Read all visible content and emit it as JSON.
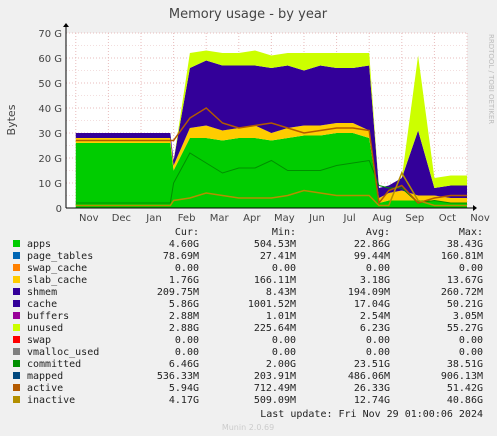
{
  "chart_data": {
    "type": "area",
    "title": "Memory usage - by year",
    "ylabel": "Bytes",
    "side_label": "RRDTOOL / TOBI OETIKER",
    "footer": "Munin 2.0.69",
    "last_update": "Last update: Fri Nov 29 01:00:06 2024",
    "ylim": [
      0,
      70
    ],
    "y_unit": "G",
    "y_ticks": [
      "0",
      "10 G",
      "20 G",
      "30 G",
      "40 G",
      "50 G",
      "60 G",
      "70 G"
    ],
    "x_ticks": [
      "Nov",
      "Dec",
      "Jan",
      "Feb",
      "Mar",
      "Apr",
      "May",
      "Jun",
      "Jul",
      "Aug",
      "Sep",
      "Oct",
      "Nov"
    ],
    "grid": true,
    "legend_headers": [
      "Cur:",
      "Min:",
      "Avg:",
      "Max:"
    ],
    "series": [
      {
        "name": "apps",
        "color": "#00cc00",
        "cur": "4.60G",
        "min": "504.53M",
        "avg": "22.86G",
        "max": "38.43G"
      },
      {
        "name": "page_tables",
        "color": "#0066b3",
        "cur": "78.69M",
        "min": "27.41M",
        "avg": "99.44M",
        "max": "160.81M"
      },
      {
        "name": "swap_cache",
        "color": "#ff8000",
        "cur": "0.00",
        "min": "0.00",
        "avg": "0.00",
        "max": "0.00"
      },
      {
        "name": "slab_cache",
        "color": "#ffcc00",
        "cur": "1.76G",
        "min": "166.11M",
        "avg": "3.18G",
        "max": "13.67G"
      },
      {
        "name": "shmem",
        "color": "#330099",
        "cur": "209.75M",
        "min": "8.43M",
        "avg": "194.09M",
        "max": "260.72M"
      },
      {
        "name": "cache",
        "color": "#330099",
        "cur": "5.86G",
        "min": "1001.52M",
        "avg": "17.04G",
        "max": "50.21G"
      },
      {
        "name": "buffers",
        "color": "#990099",
        "cur": "2.88M",
        "min": "1.01M",
        "avg": "2.54M",
        "max": "3.05M"
      },
      {
        "name": "unused",
        "color": "#ccff00",
        "cur": "2.88G",
        "min": "225.64M",
        "avg": "6.23G",
        "max": "55.27G"
      },
      {
        "name": "swap",
        "color": "#ff0000",
        "cur": "0.00",
        "min": "0.00",
        "avg": "0.00",
        "max": "0.00"
      },
      {
        "name": "vmalloc_used",
        "color": "#808080",
        "cur": "0.00",
        "min": "0.00",
        "avg": "0.00",
        "max": "0.00"
      },
      {
        "name": "committed",
        "color": "#008f00",
        "cur": "6.46G",
        "min": "2.00G",
        "avg": "23.51G",
        "max": "38.51G"
      },
      {
        "name": "mapped",
        "color": "#00487d",
        "cur": "536.33M",
        "min": "203.91M",
        "avg": "486.06M",
        "max": "906.13M"
      },
      {
        "name": "active",
        "color": "#b35a00",
        "cur": "5.94G",
        "min": "712.49M",
        "avg": "26.33G",
        "max": "51.42G"
      },
      {
        "name": "inactive",
        "color": "#b38f00",
        "cur": "4.17G",
        "min": "509.09M",
        "avg": "12.74G",
        "max": "40.86G"
      }
    ],
    "plot_series": {
      "x": [
        0,
        1,
        2,
        2.9,
        3.0,
        3.5,
        4,
        4.5,
        5,
        5.5,
        6,
        6.5,
        7,
        7.5,
        8,
        8.5,
        9,
        9.3,
        9.6,
        10,
        10.5,
        11,
        11.5,
        12.0
      ],
      "apps": [
        26,
        26,
        26,
        26,
        15,
        28,
        28,
        27,
        28,
        28,
        27,
        28,
        29,
        29,
        30,
        30,
        28,
        2,
        3,
        3,
        3,
        3,
        2,
        2
      ],
      "slab": [
        2,
        2,
        2,
        2,
        2,
        4,
        5,
        4,
        4,
        5,
        3,
        4,
        4,
        4,
        4,
        4,
        3,
        2,
        3,
        4,
        2,
        2,
        2,
        2
      ],
      "cache": [
        2,
        2,
        2,
        2,
        2,
        24,
        26,
        26,
        25,
        24,
        26,
        25,
        22,
        24,
        22,
        22,
        26,
        4,
        3,
        5,
        26,
        3,
        5,
        5
      ],
      "unused": [
        0,
        0,
        0,
        0,
        0,
        6,
        4,
        5,
        5,
        6,
        5,
        5,
        7,
        5,
        6,
        6,
        5,
        0,
        0,
        0,
        30,
        4,
        4,
        4
      ],
      "committed": [
        2,
        2,
        2,
        2,
        10,
        22,
        18,
        14,
        16,
        16,
        19,
        15,
        15,
        15,
        17,
        18,
        19,
        9,
        8,
        8,
        2,
        3,
        2,
        2
      ],
      "active": [
        27,
        27,
        27,
        27,
        27,
        36,
        40,
        34,
        32,
        33,
        34,
        32,
        30,
        31,
        32,
        32,
        31,
        2,
        7,
        9,
        2,
        4,
        5,
        5
      ],
      "inactive": [
        1,
        1,
        1,
        1,
        3,
        4,
        6,
        5,
        4,
        4,
        4,
        5,
        7,
        6,
        5,
        5,
        5,
        1,
        1,
        14,
        3,
        1,
        1,
        1
      ]
    }
  }
}
